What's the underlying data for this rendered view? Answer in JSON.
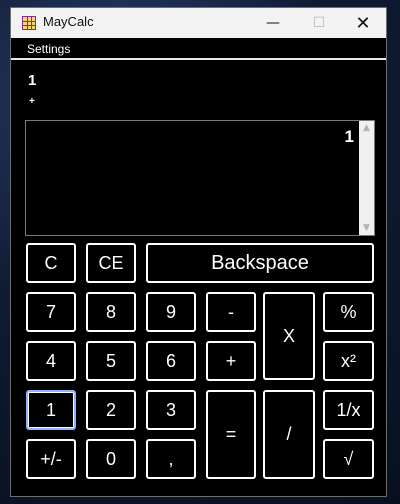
{
  "window": {
    "title": "MayCalc",
    "controls": {
      "minimize": "—",
      "maximize": "☐",
      "close": "✕"
    }
  },
  "menu": {
    "settings": "Settings"
  },
  "expression": {
    "value": "1",
    "operator": "+"
  },
  "display": {
    "value": "1"
  },
  "buttons": {
    "row1": [
      "C",
      "CE",
      "Backspace"
    ],
    "row2": [
      "7",
      "8",
      "9",
      "-",
      "X",
      "%"
    ],
    "row3": [
      "4",
      "5",
      "6",
      "+",
      "x²"
    ],
    "row4": [
      "1",
      "2",
      "3",
      "=",
      "/",
      "1/x"
    ],
    "row5": [
      "+/-",
      "0",
      ",",
      "√"
    ]
  },
  "scrollbar": {
    "up": "▲",
    "down": "▼"
  },
  "icons": {
    "app": "calculator-icon"
  },
  "colors": {
    "background": "#000000",
    "text": "#ffffff",
    "focus_outline": "#8fb5ff"
  }
}
